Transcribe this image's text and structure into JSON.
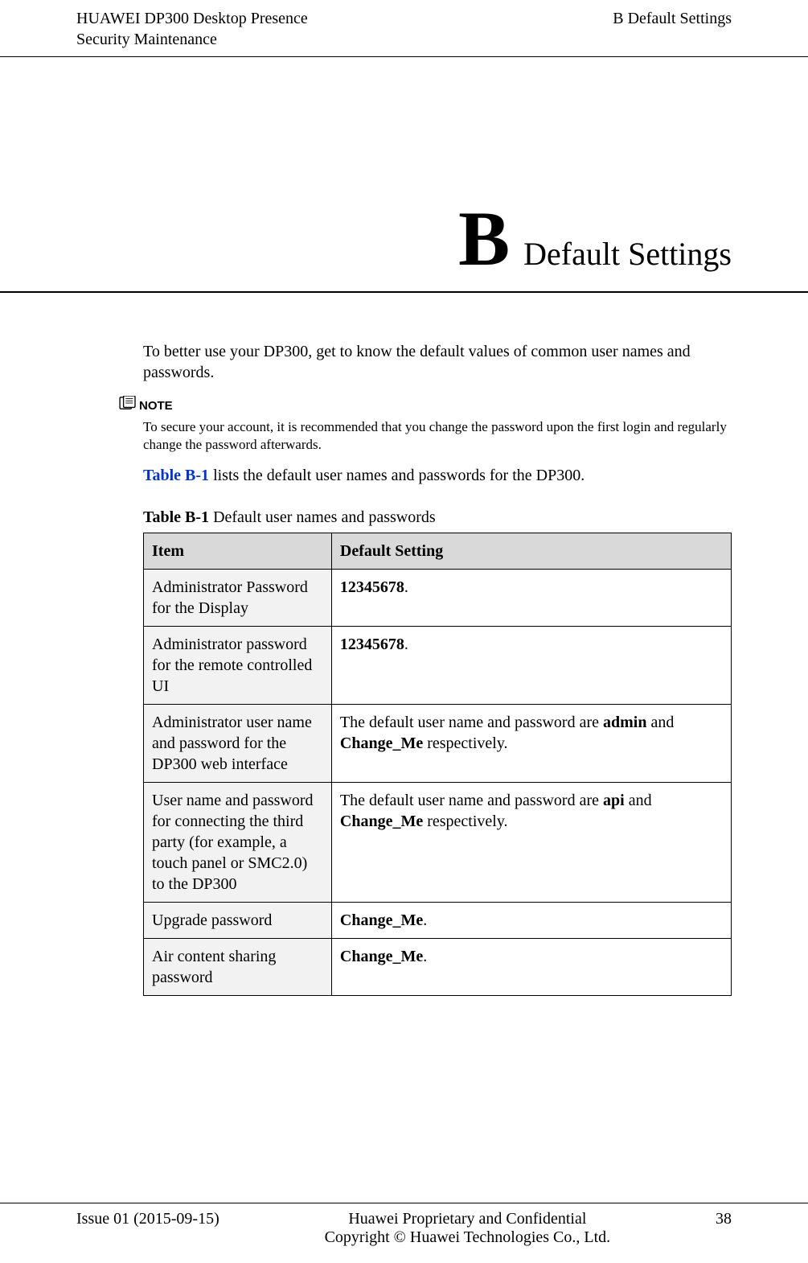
{
  "header": {
    "product_line1": "HUAWEI DP300 Desktop Presence",
    "product_line2": "Security Maintenance",
    "section": "B Default Settings"
  },
  "chapter": {
    "letter": "B",
    "title": "Default Settings"
  },
  "intro": "To better use your DP300, get to know the default values of common user names and passwords.",
  "note": {
    "label": "NOTE",
    "text": "To secure your account, it is recommended that you change the password upon the first login and regularly change the password afterwards."
  },
  "ref_para_link": "Table B-1",
  "ref_para_rest": " lists the default user names and passwords for the DP300.",
  "table": {
    "caption_prefix": "Table B-1",
    "caption_rest": " Default user names and passwords",
    "headers": [
      "Item",
      "Default Setting"
    ],
    "rows": [
      {
        "item": "Administrator Password for the Display",
        "setting_pre": "",
        "setting_b1": "12345678",
        "setting_mid": ".",
        "setting_b2": "",
        "setting_post": ""
      },
      {
        "item": "Administrator password for the remote controlled UI",
        "setting_pre": "",
        "setting_b1": "12345678",
        "setting_mid": ".",
        "setting_b2": "",
        "setting_post": ""
      },
      {
        "item": "Administrator user name and password for the DP300 web interface",
        "setting_pre": "The default user name and password are ",
        "setting_b1": "admin",
        "setting_mid": " and ",
        "setting_b2": "Change_Me",
        "setting_post": " respectively."
      },
      {
        "item": "User name and password for connecting the third party (for example, a touch panel or SMC2.0) to the DP300",
        "setting_pre": "The default user name and password are ",
        "setting_b1": "api",
        "setting_mid": " and ",
        "setting_b2": "Change_Me",
        "setting_post": " respectively."
      },
      {
        "item": "Upgrade password",
        "setting_pre": "",
        "setting_b1": "Change_Me",
        "setting_mid": ".",
        "setting_b2": "",
        "setting_post": ""
      },
      {
        "item": "Air content sharing password",
        "setting_pre": "",
        "setting_b1": "Change_Me",
        "setting_mid": ".",
        "setting_b2": "",
        "setting_post": ""
      }
    ]
  },
  "footer": {
    "issue": "Issue 01 (2015-09-15)",
    "center_line1": "Huawei Proprietary and Confidential",
    "center_line2": "Copyright © Huawei Technologies Co., Ltd.",
    "page": "38"
  }
}
